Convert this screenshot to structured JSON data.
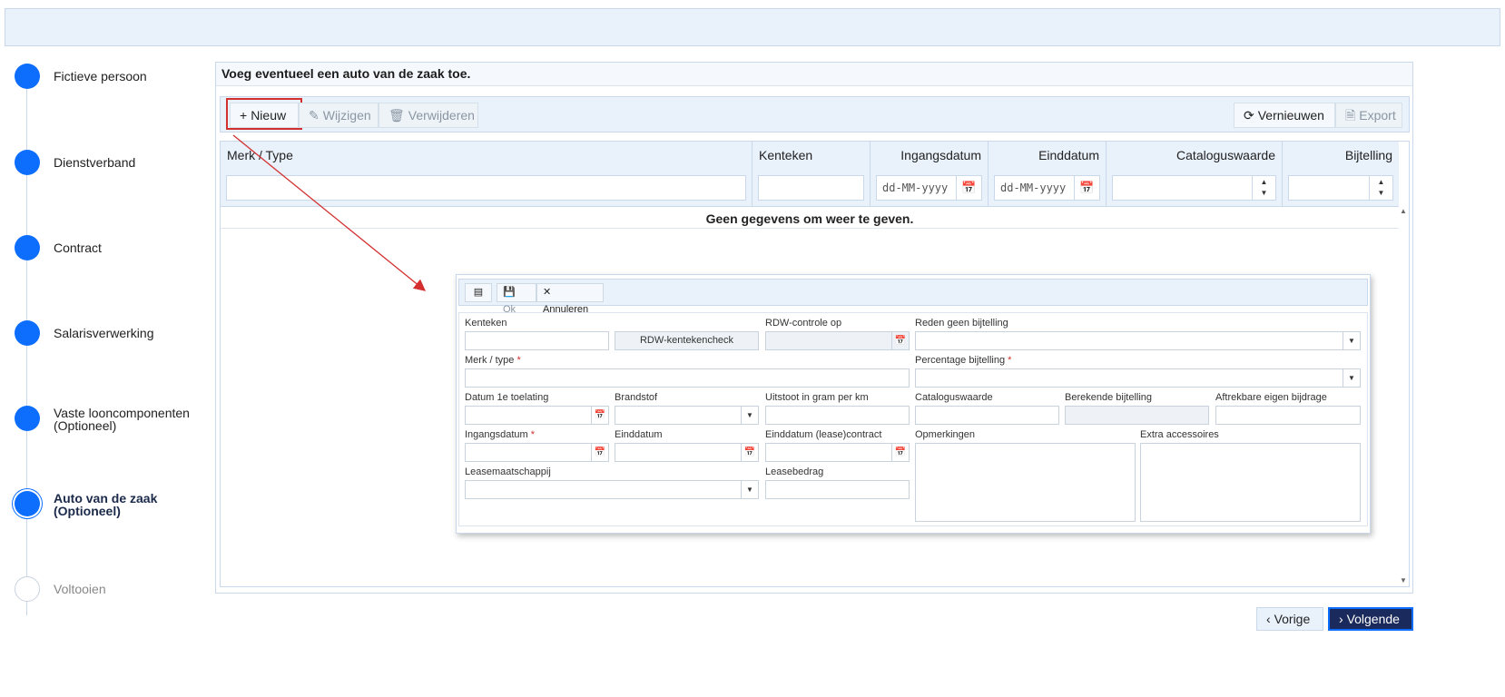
{
  "steps": [
    {
      "label": "Fictieve persoon",
      "state": "done"
    },
    {
      "label": "Dienstverband",
      "state": "done"
    },
    {
      "label": "Contract",
      "state": "done"
    },
    {
      "label": "Salarisverwerking",
      "state": "done"
    },
    {
      "label": "Vaste looncomponenten (Optioneel)",
      "state": "done"
    },
    {
      "label": "Auto van de zaak (Optioneel)",
      "state": "active"
    },
    {
      "label": "Voltooien",
      "state": "pending"
    }
  ],
  "panel": {
    "title": "Voeg eventueel een auto van de zaak toe."
  },
  "toolbar": {
    "new_label": "Nieuw",
    "edit_label": "Wijzigen",
    "delete_label": "Verwijderen",
    "refresh_label": "Vernieuwen",
    "export_label": "Export"
  },
  "grid": {
    "columns": [
      "Merk / Type",
      "Kenteken",
      "Ingangsdatum",
      "Einddatum",
      "Cataloguswaarde",
      "Bijtelling"
    ],
    "date_placeholder": "dd-MM-yyyy",
    "empty_message": "Geen gegevens om weer te geven."
  },
  "popup": {
    "ok_label": "Ok",
    "cancel_label": "Annuleren",
    "fields": {
      "kenteken": "Kenteken",
      "rdw_check": "RDW-kentekencheck",
      "rdw_controle_op": "RDW-controle op",
      "reden_geen_bijtelling": "Reden geen bijtelling",
      "merk_type": "Merk / type",
      "percentage_bijtelling": "Percentage bijtelling",
      "datum_1e_toelating": "Datum 1e toelating",
      "brandstof": "Brandstof",
      "uitstoot": "Uitstoot in gram per km",
      "cataloguswaarde": "Cataloguswaarde",
      "berekende_bijtelling": "Berekende bijtelling",
      "aftrekbare_eigen_bijdrage": "Aftrekbare eigen bijdrage",
      "ingangsdatum": "Ingangsdatum",
      "einddatum": "Einddatum",
      "einddatum_lease": "Einddatum (lease)contract",
      "opmerkingen": "Opmerkingen",
      "extra_accessoires": "Extra accessoires",
      "leasemaatschappij": "Leasemaatschappij",
      "leasebedrag": "Leasebedrag"
    }
  },
  "nav": {
    "prev_label": "Vorige",
    "next_label": "Volgende"
  },
  "colors": {
    "primary": "#0d6efd",
    "header_bg": "#e9f1fb",
    "annotation": "#d32f2f",
    "next_button": "#1b2a5c"
  }
}
